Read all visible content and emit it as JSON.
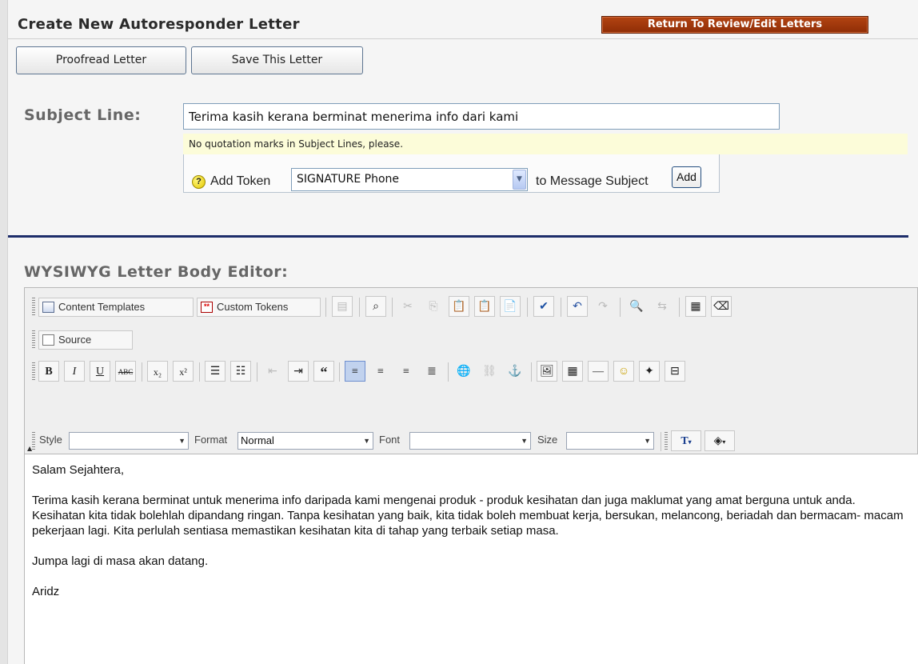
{
  "header": {
    "title": "Create New Autoresponder Letter",
    "return_button": "Return To Review/Edit Letters"
  },
  "actions": {
    "proofread": "Proofread Letter",
    "save": "Save This Letter"
  },
  "subject": {
    "label": "Subject Line:",
    "value": "Terima kasih kerana berminat menerima info dari kami",
    "hint": "No quotation marks in Subject Lines, please.",
    "add_token_label": "Add Token",
    "token_selected": "SIGNATURE Phone",
    "to_subject_label": "to Message Subject",
    "add_button": "Add",
    "help_icon": "?"
  },
  "editor": {
    "label": "WYSIWYG Letter Body Editor:",
    "toolbar": {
      "content_templates": "Content Templates",
      "custom_tokens": "Custom Tokens",
      "source": "Source",
      "custom_tokens_icon": "**",
      "style_label": "Style",
      "style_value": "",
      "format_label": "Format",
      "format_value": "Normal",
      "font_label": "Font",
      "font_value": "",
      "size_label": "Size",
      "size_value": "",
      "icons_row1": [
        "paste-plain-icon",
        "preview-icon",
        "cut-icon",
        "copy-icon",
        "paste-icon",
        "paste-text-icon",
        "paste-word-icon",
        "spellcheck-icon",
        "undo-icon",
        "redo-icon",
        "find-icon",
        "replace-icon",
        "select-all-icon",
        "remove-format-icon"
      ],
      "icons_row2": [
        "bold-icon",
        "italic-icon",
        "underline-icon",
        "strikethrough-icon",
        "subscript-icon",
        "superscript-icon",
        "numbered-list-icon",
        "bulleted-list-icon",
        "outdent-icon",
        "indent-icon",
        "blockquote-icon",
        "align-left-icon",
        "align-center-icon",
        "align-right-icon",
        "justify-icon",
        "link-icon",
        "unlink-icon",
        "anchor-icon",
        "image-icon",
        "table-icon",
        "horizontal-rule-icon",
        "smiley-icon",
        "special-char-icon",
        "page-break-icon"
      ],
      "glyphs": {
        "bold": "B",
        "italic": "I",
        "underline": "U",
        "strike": "ABC",
        "subscript": "x₂",
        "superscript": "x²",
        "blockquote": "“",
        "text_color": "T"
      }
    },
    "body": [
      "Salam Sejahtera,",
      "Terima kasih kerana berminat untuk menerima info daripada kami mengenai produk - produk kesihatan dan juga maklumat yang amat berguna untuk anda. Kesihatan kita tidak bolehlah dipandang ringan. Tanpa kesihatan yang baik, kita tidak boleh membuat kerja, bersukan, melancong, beriadah dan bermacam- macam pekerjaan lagi. Kita perlulah sentiasa memastikan kesihatan kita di tahap yang terbaik setiap masa.",
      "Jumpa lagi di masa akan datang.",
      "Aridz"
    ]
  },
  "colors": {
    "return_button_bg": "#9c3a0d",
    "hint_bg": "#fcfcd9",
    "divider": "#1d2d6a",
    "label_gray": "#666666"
  }
}
